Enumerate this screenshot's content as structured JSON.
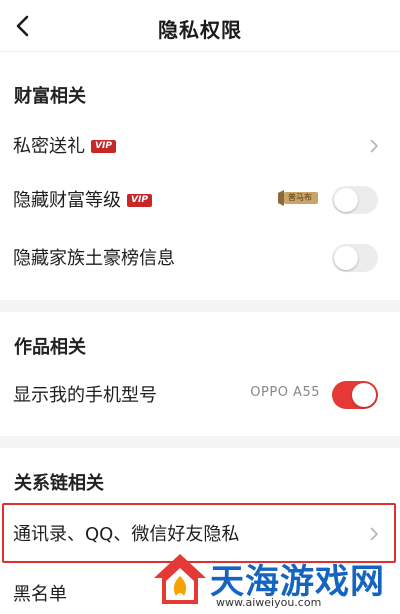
{
  "header": {
    "title": "隐私权限"
  },
  "sections": {
    "wealth": "财富相关",
    "works": "作品相关",
    "relations": "关系链相关"
  },
  "rows": {
    "private_gift": {
      "label": "私密送礼",
      "badge": "VIP"
    },
    "hide_wealth_level": {
      "label": "隐藏财富等级",
      "badge": "VIP",
      "gold_badge": "普马布",
      "toggle_on": false
    },
    "hide_family_rank": {
      "label": "隐藏家族土豪榜信息",
      "toggle_on": false
    },
    "show_phone_model": {
      "label": "显示我的手机型号",
      "value": "OPPO A55",
      "toggle_on": true
    },
    "contacts_privacy": {
      "label": "通讯录、QQ、微信好友隐私"
    },
    "blacklist": {
      "label": "黑名单"
    }
  },
  "watermark": {
    "brand": "天海游戏网",
    "url": "www.aiweiyou.com"
  },
  "colors": {
    "accent": "#e53935",
    "toggle_off": "#ececec",
    "watermark_blue": "#1565c0"
  }
}
